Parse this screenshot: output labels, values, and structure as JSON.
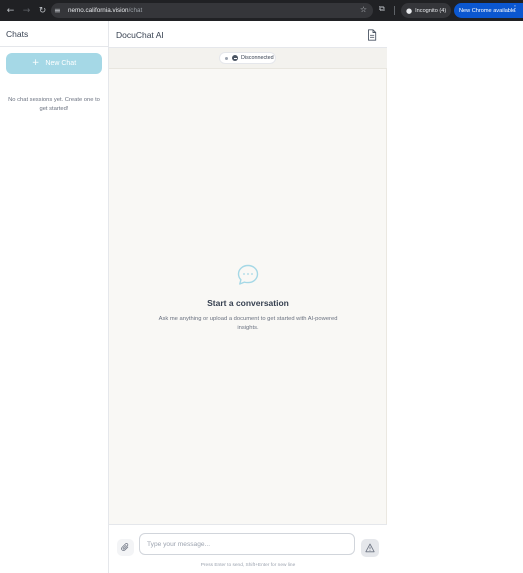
{
  "browser": {
    "nav": {
      "back_icon": "arrow-left-icon",
      "forward_icon": "arrow-right-icon",
      "reload_icon": "reload-icon"
    },
    "url_host": "nemo.california.vision",
    "url_path": "/chat",
    "incognito_label": "Incognito (4)",
    "update_label": "New Chrome available",
    "colors": {
      "frame": "#202124",
      "omnibox": "#35363a",
      "update_pill": "#0b57d0"
    }
  },
  "sidebar": {
    "title": "Chats",
    "new_chat_label": "New Chat",
    "empty_text": "No chat sessions yet. Create one to get started!",
    "colors": {
      "new_chat_bg": "#a5d8e6"
    }
  },
  "header": {
    "title": "DocuChat AI",
    "document_icon": "document-icon"
  },
  "status": {
    "label": "Disconnected",
    "state": "disconnected",
    "icon": "minus-circle-icon"
  },
  "empty_state": {
    "icon": "chat-bubble-icon",
    "title": "Start a conversation",
    "subtitle": "Ask me anything or upload a document to get started with AI-powered insights."
  },
  "composer": {
    "attach_icon": "paperclip-icon",
    "placeholder": "Type your message...",
    "value": "",
    "send_icon": "warning-icon",
    "hint": "Press Enter to send, Shift+Enter for new line"
  },
  "colors": {
    "main_bg": "#f9f8f5",
    "accent": "#a5d8e6"
  }
}
